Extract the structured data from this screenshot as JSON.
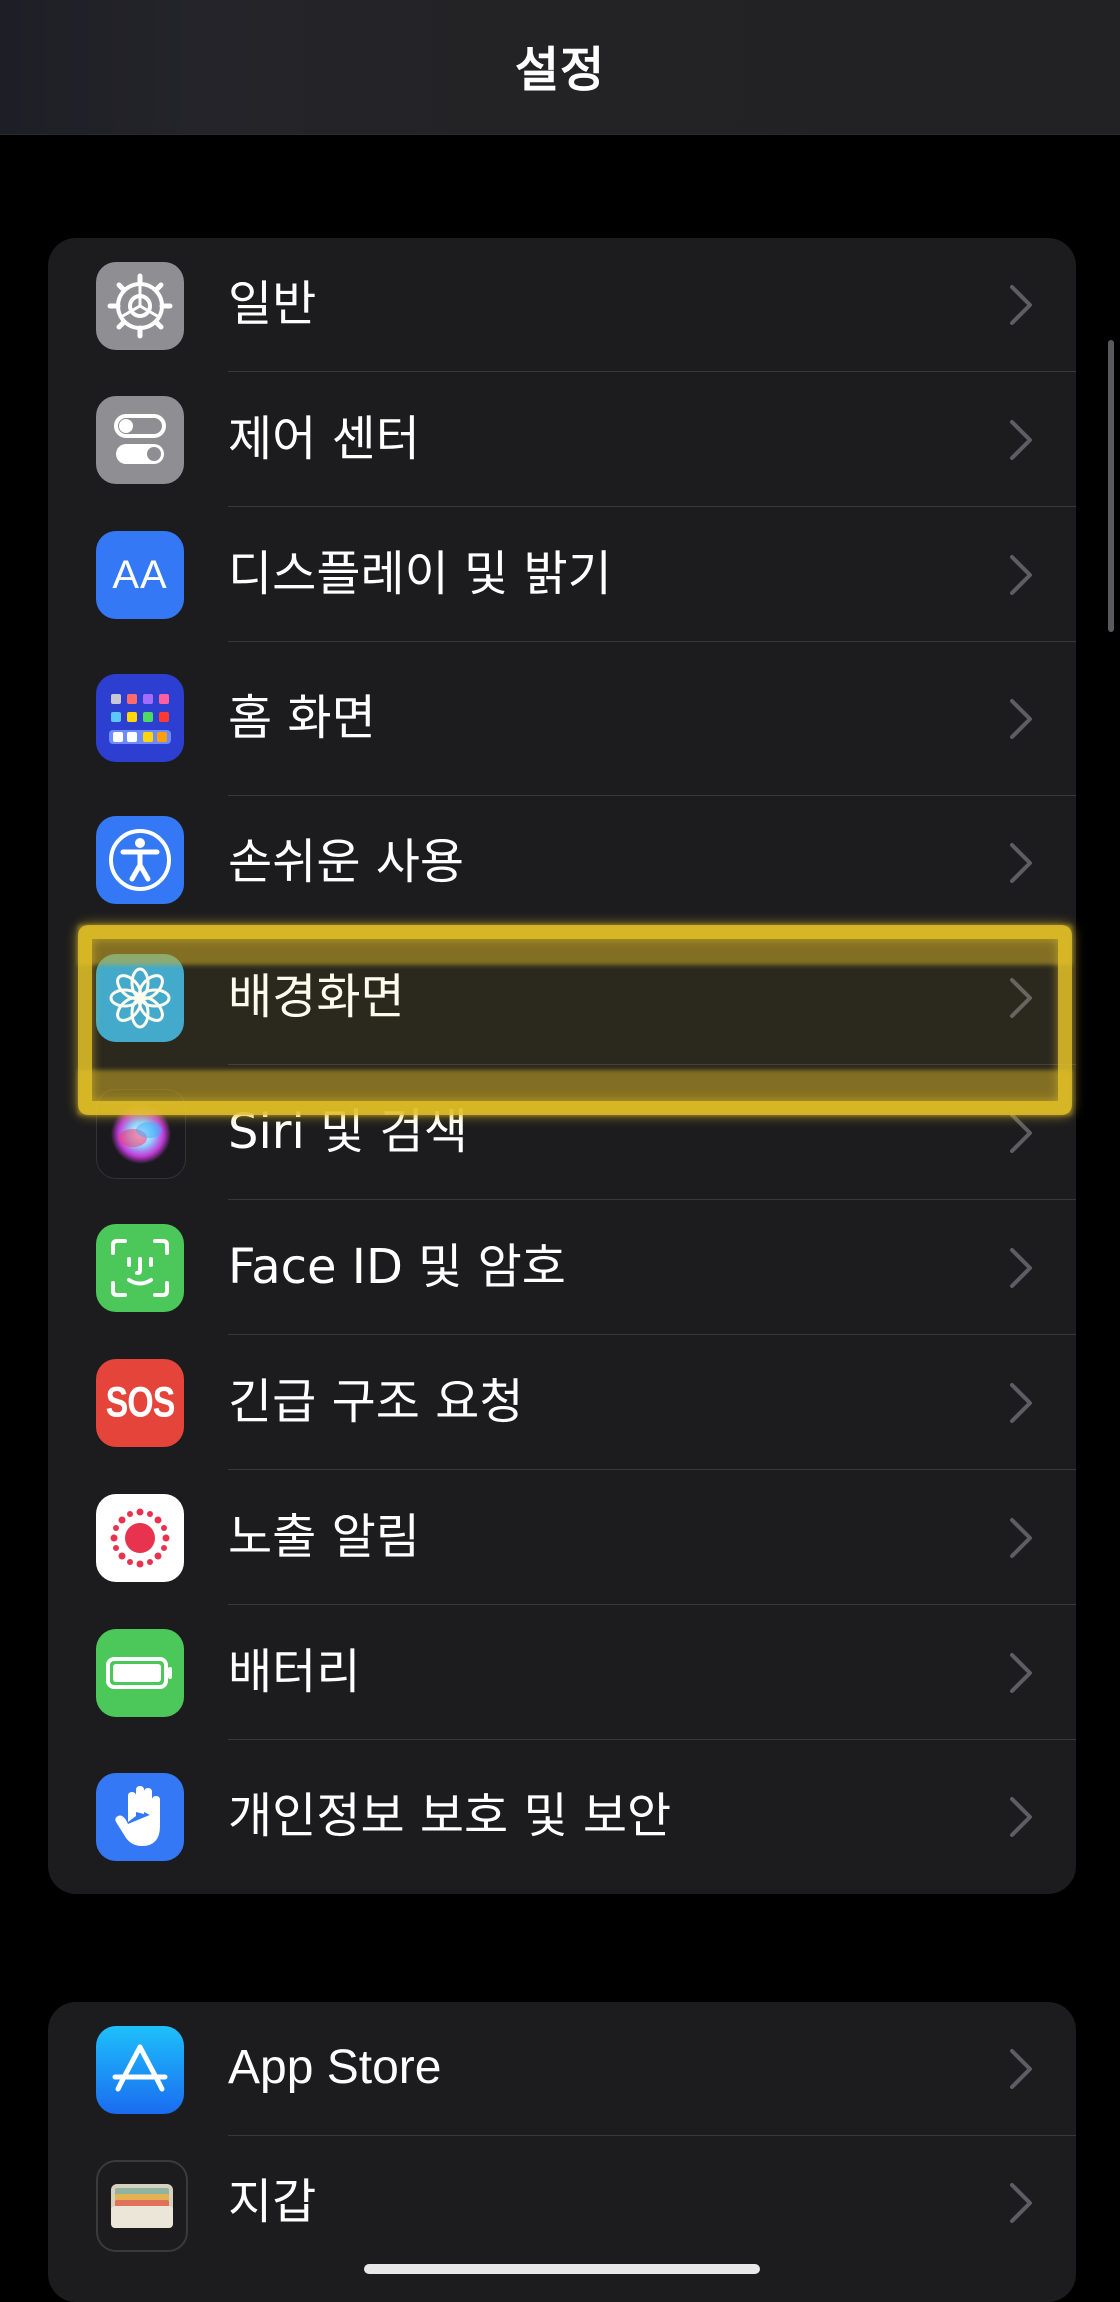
{
  "navbar": {
    "title": "설정"
  },
  "group1": {
    "items": [
      {
        "label": "일반",
        "icon": "gear-icon",
        "icon_bg": "#8e8e93"
      },
      {
        "label": "제어 센터",
        "icon": "toggles-icon",
        "icon_bg": "#8e8e93"
      },
      {
        "label": "디스플레이 및 밝기",
        "icon": "text-size-icon",
        "icon_bg": "#3478f6",
        "icon_text": "AA"
      },
      {
        "label": "홈 화면",
        "icon": "home-grid-icon",
        "icon_bg": "#2c3fd1"
      },
      {
        "label": "손쉬운 사용",
        "icon": "accessibility-icon",
        "icon_bg": "#3478f6"
      },
      {
        "label": "배경화면",
        "icon": "flower-icon",
        "icon_bg": "#36a9d9"
      },
      {
        "label": "Siri 및 검색",
        "icon": "siri-icon",
        "icon_bg": "#1a1a1e"
      },
      {
        "label": "Face ID 및 암호",
        "icon": "face-id-icon",
        "icon_bg": "#4cc75a"
      },
      {
        "label": "긴급 구조 요청",
        "icon": "sos-icon",
        "icon_bg": "#e5443a",
        "icon_text": "SOS"
      },
      {
        "label": "노출 알림",
        "icon": "exposure-icon",
        "icon_bg": "#ffffff"
      },
      {
        "label": "배터리",
        "icon": "battery-icon",
        "icon_bg": "#4cc75a"
      },
      {
        "label": "개인정보 보호 및 보안",
        "icon": "hand-icon",
        "icon_bg": "#3478f6"
      }
    ]
  },
  "group2": {
    "items": [
      {
        "label": "App Store",
        "icon": "app-store-icon",
        "icon_bg": "#1a8cf5"
      },
      {
        "label": "지갑",
        "icon": "wallet-icon",
        "icon_bg": "#1c1c1e"
      }
    ]
  },
  "colors": {
    "highlight": "#e6c328",
    "group_bg": "#1c1c1e",
    "divider": "#38383a",
    "chevron": "#5e5e62"
  }
}
